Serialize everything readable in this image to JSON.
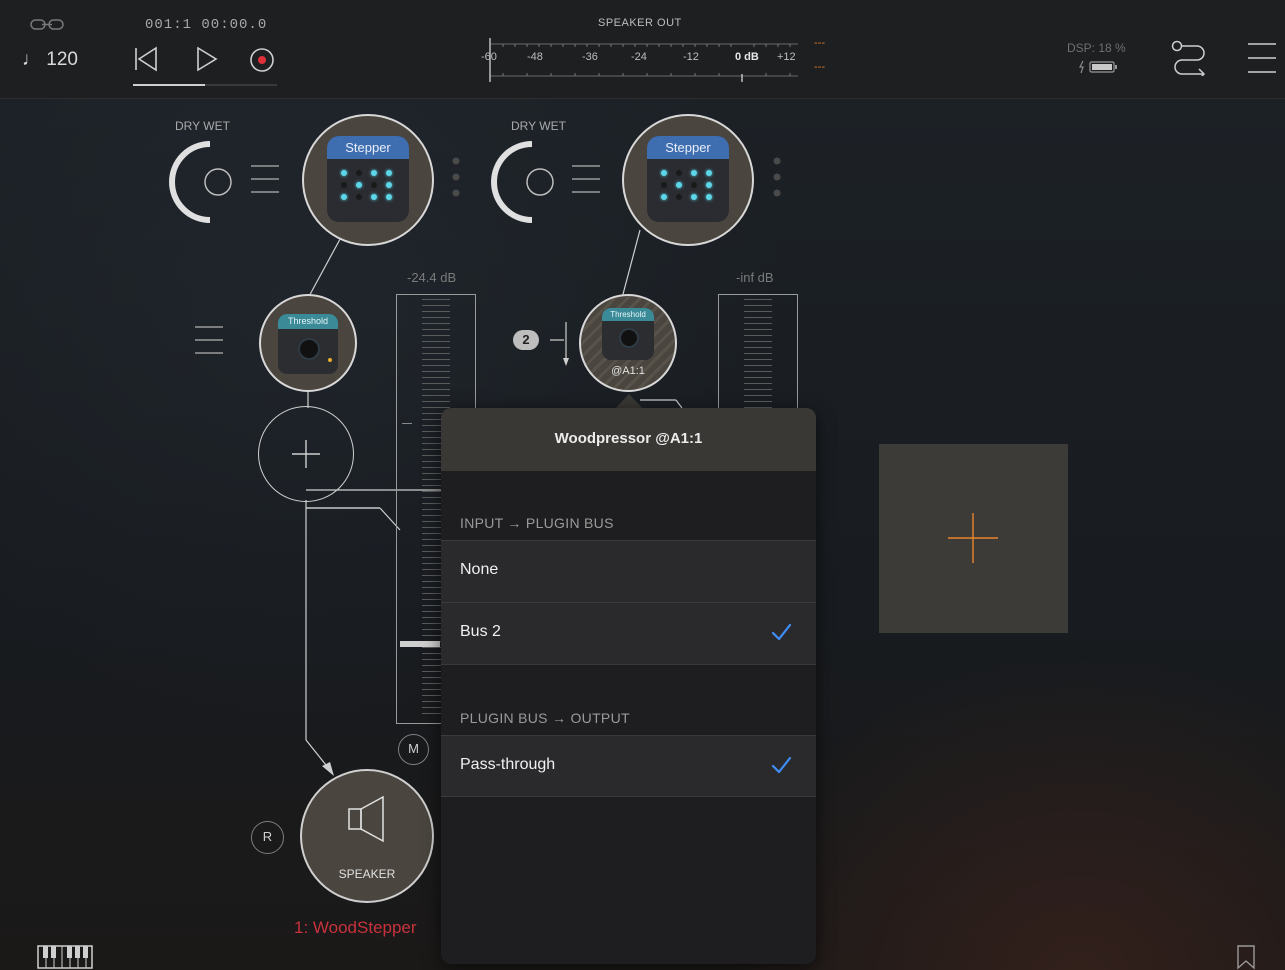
{
  "transport": {
    "tempo": "♩ 120",
    "position": "001:1  00:00.0"
  },
  "meter": {
    "title": "SPEAKER OUT",
    "scale": [
      "-60",
      "-48",
      "-36",
      "-24",
      "-12",
      "0 dB",
      "+12"
    ],
    "peak_left": "---",
    "peak_right": "---"
  },
  "status": {
    "dsp": "DSP: 18 %"
  },
  "colors": {
    "accent_blue": "#3f8ef5",
    "record_red": "#e0303a",
    "track_name_red": "#c8323c",
    "add_orange": "#e8862c",
    "meter_peak": "#d87a2a"
  },
  "chains": [
    {
      "dry_wet_label": "DRY WET",
      "plugin_name": "Stepper",
      "fx_name": "Threshold",
      "level": "-24.4 dB"
    },
    {
      "dry_wet_label": "DRY WET",
      "plugin_name": "Stepper",
      "fx_name": "Threshold",
      "fx_tag": "@A1:1",
      "bus_badge": "2",
      "level": "-inf dB"
    }
  ],
  "output": {
    "speaker_label": "SPEAKER",
    "mute_label": "M",
    "record_label": "R",
    "track_name": "1: WoodStepper"
  },
  "popover": {
    "title": "Woodpressor @A1:1",
    "section1": "INPUT → PLUGIN BUS",
    "options1": [
      {
        "label": "None",
        "checked": false
      },
      {
        "label": "Bus 2",
        "checked": true
      }
    ],
    "section2": "PLUGIN BUS → OUTPUT",
    "options2": [
      {
        "label": "Pass-through",
        "checked": true
      }
    ]
  },
  "icons": [
    "link-icon",
    "rewind-icon",
    "play-icon",
    "record-icon",
    "battery-icon",
    "routing-icon",
    "menu-icon",
    "keyboard-icon",
    "bookmark-icon",
    "add-icon",
    "speaker-icon",
    "checkmark-icon"
  ]
}
